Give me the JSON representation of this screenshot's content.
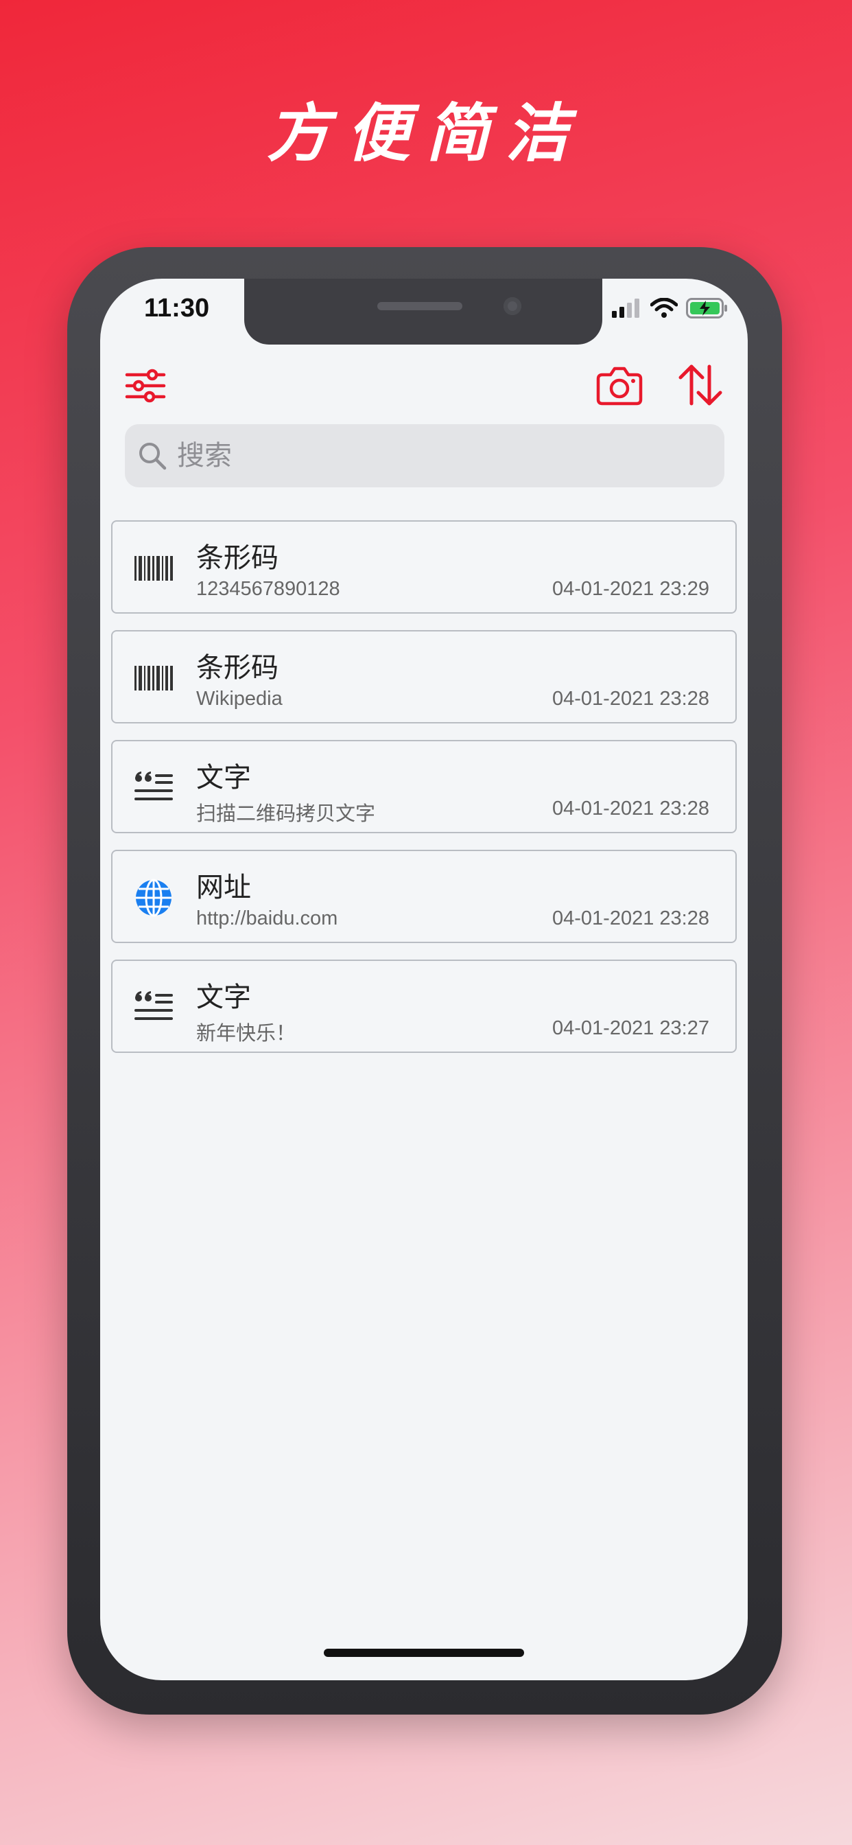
{
  "promo": {
    "title": "方便简洁"
  },
  "status_bar": {
    "time": "11:30"
  },
  "toolbar": {
    "filter_icon": "sliders-icon",
    "camera_icon": "camera-icon",
    "sort_icon": "sort-arrows-icon"
  },
  "search": {
    "placeholder": "搜索",
    "value": ""
  },
  "history": [
    {
      "type_icon": "barcode-icon",
      "title": "条形码",
      "content": "1234567890128",
      "datetime": "04-01-2021 23:29"
    },
    {
      "type_icon": "barcode-icon",
      "title": "条形码",
      "content": "Wikipedia",
      "datetime": "04-01-2021 23:28"
    },
    {
      "type_icon": "text-quote-icon",
      "title": "文字",
      "content": "扫描二维码拷贝文字",
      "datetime": "04-01-2021 23:28"
    },
    {
      "type_icon": "globe-icon",
      "title": "网址",
      "content": "http://baidu.com",
      "datetime": "04-01-2021 23:28"
    },
    {
      "type_icon": "text-quote-icon",
      "title": "文字",
      "content": "新年快乐！",
      "datetime": "04-01-2021 23:27"
    }
  ],
  "colors": {
    "accent": "#e8192c",
    "link_blue": "#1a7ff0",
    "battery_green": "#35c759"
  }
}
